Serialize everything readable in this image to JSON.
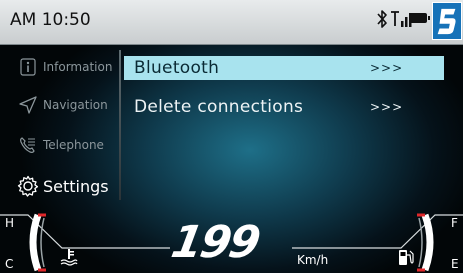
{
  "status_bar": {
    "time": "AM 10:50",
    "icons": [
      "bluetooth-icon",
      "signal-icon",
      "battery-icon",
      "mode-5-badge-icon"
    ]
  },
  "sidebar": {
    "items": [
      {
        "label": "Information",
        "icon": "info-icon",
        "active": false
      },
      {
        "label": "Navigation",
        "icon": "navigation-arrow-icon",
        "active": false
      },
      {
        "label": "Telephone",
        "icon": "phone-icon",
        "active": false
      },
      {
        "label": "Settings",
        "icon": "gear-icon",
        "active": true
      }
    ]
  },
  "menu": {
    "items": [
      {
        "label": "Bluetooth",
        "arrow": ">>>",
        "selected": true
      },
      {
        "label": "Delete connections",
        "arrow": ">>>",
        "selected": false
      }
    ]
  },
  "cluster": {
    "speed": "199",
    "speed_unit": "Km/h",
    "temp_gauge": {
      "high_label": "H",
      "low_label": "C"
    },
    "fuel_gauge": {
      "full_label": "F",
      "empty_label": "E",
      "level": 1.0
    }
  },
  "colors": {
    "accent": "#a8e3ee",
    "brand_badge": "#1672b8",
    "gauge_red": "#e0272a"
  }
}
